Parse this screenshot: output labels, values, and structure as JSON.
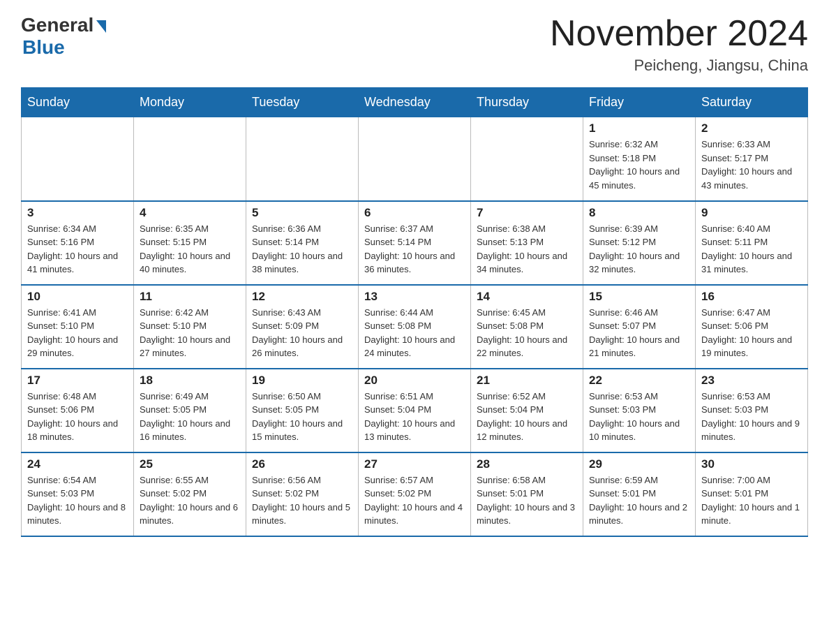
{
  "header": {
    "logo_general": "General",
    "logo_blue": "Blue",
    "month_year": "November 2024",
    "location": "Peicheng, Jiangsu, China"
  },
  "weekdays": [
    "Sunday",
    "Monday",
    "Tuesday",
    "Wednesday",
    "Thursday",
    "Friday",
    "Saturday"
  ],
  "weeks": [
    [
      {
        "day": "",
        "info": ""
      },
      {
        "day": "",
        "info": ""
      },
      {
        "day": "",
        "info": ""
      },
      {
        "day": "",
        "info": ""
      },
      {
        "day": "",
        "info": ""
      },
      {
        "day": "1",
        "info": "Sunrise: 6:32 AM\nSunset: 5:18 PM\nDaylight: 10 hours and 45 minutes."
      },
      {
        "day": "2",
        "info": "Sunrise: 6:33 AM\nSunset: 5:17 PM\nDaylight: 10 hours and 43 minutes."
      }
    ],
    [
      {
        "day": "3",
        "info": "Sunrise: 6:34 AM\nSunset: 5:16 PM\nDaylight: 10 hours and 41 minutes."
      },
      {
        "day": "4",
        "info": "Sunrise: 6:35 AM\nSunset: 5:15 PM\nDaylight: 10 hours and 40 minutes."
      },
      {
        "day": "5",
        "info": "Sunrise: 6:36 AM\nSunset: 5:14 PM\nDaylight: 10 hours and 38 minutes."
      },
      {
        "day": "6",
        "info": "Sunrise: 6:37 AM\nSunset: 5:14 PM\nDaylight: 10 hours and 36 minutes."
      },
      {
        "day": "7",
        "info": "Sunrise: 6:38 AM\nSunset: 5:13 PM\nDaylight: 10 hours and 34 minutes."
      },
      {
        "day": "8",
        "info": "Sunrise: 6:39 AM\nSunset: 5:12 PM\nDaylight: 10 hours and 32 minutes."
      },
      {
        "day": "9",
        "info": "Sunrise: 6:40 AM\nSunset: 5:11 PM\nDaylight: 10 hours and 31 minutes."
      }
    ],
    [
      {
        "day": "10",
        "info": "Sunrise: 6:41 AM\nSunset: 5:10 PM\nDaylight: 10 hours and 29 minutes."
      },
      {
        "day": "11",
        "info": "Sunrise: 6:42 AM\nSunset: 5:10 PM\nDaylight: 10 hours and 27 minutes."
      },
      {
        "day": "12",
        "info": "Sunrise: 6:43 AM\nSunset: 5:09 PM\nDaylight: 10 hours and 26 minutes."
      },
      {
        "day": "13",
        "info": "Sunrise: 6:44 AM\nSunset: 5:08 PM\nDaylight: 10 hours and 24 minutes."
      },
      {
        "day": "14",
        "info": "Sunrise: 6:45 AM\nSunset: 5:08 PM\nDaylight: 10 hours and 22 minutes."
      },
      {
        "day": "15",
        "info": "Sunrise: 6:46 AM\nSunset: 5:07 PM\nDaylight: 10 hours and 21 minutes."
      },
      {
        "day": "16",
        "info": "Sunrise: 6:47 AM\nSunset: 5:06 PM\nDaylight: 10 hours and 19 minutes."
      }
    ],
    [
      {
        "day": "17",
        "info": "Sunrise: 6:48 AM\nSunset: 5:06 PM\nDaylight: 10 hours and 18 minutes."
      },
      {
        "day": "18",
        "info": "Sunrise: 6:49 AM\nSunset: 5:05 PM\nDaylight: 10 hours and 16 minutes."
      },
      {
        "day": "19",
        "info": "Sunrise: 6:50 AM\nSunset: 5:05 PM\nDaylight: 10 hours and 15 minutes."
      },
      {
        "day": "20",
        "info": "Sunrise: 6:51 AM\nSunset: 5:04 PM\nDaylight: 10 hours and 13 minutes."
      },
      {
        "day": "21",
        "info": "Sunrise: 6:52 AM\nSunset: 5:04 PM\nDaylight: 10 hours and 12 minutes."
      },
      {
        "day": "22",
        "info": "Sunrise: 6:53 AM\nSunset: 5:03 PM\nDaylight: 10 hours and 10 minutes."
      },
      {
        "day": "23",
        "info": "Sunrise: 6:53 AM\nSunset: 5:03 PM\nDaylight: 10 hours and 9 minutes."
      }
    ],
    [
      {
        "day": "24",
        "info": "Sunrise: 6:54 AM\nSunset: 5:03 PM\nDaylight: 10 hours and 8 minutes."
      },
      {
        "day": "25",
        "info": "Sunrise: 6:55 AM\nSunset: 5:02 PM\nDaylight: 10 hours and 6 minutes."
      },
      {
        "day": "26",
        "info": "Sunrise: 6:56 AM\nSunset: 5:02 PM\nDaylight: 10 hours and 5 minutes."
      },
      {
        "day": "27",
        "info": "Sunrise: 6:57 AM\nSunset: 5:02 PM\nDaylight: 10 hours and 4 minutes."
      },
      {
        "day": "28",
        "info": "Sunrise: 6:58 AM\nSunset: 5:01 PM\nDaylight: 10 hours and 3 minutes."
      },
      {
        "day": "29",
        "info": "Sunrise: 6:59 AM\nSunset: 5:01 PM\nDaylight: 10 hours and 2 minutes."
      },
      {
        "day": "30",
        "info": "Sunrise: 7:00 AM\nSunset: 5:01 PM\nDaylight: 10 hours and 1 minute."
      }
    ]
  ]
}
